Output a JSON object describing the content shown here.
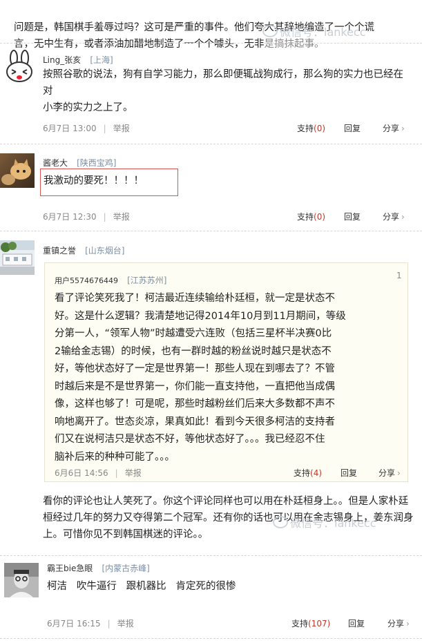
{
  "intro_text": "问题是，韩国棋手羞辱过吗？这可是严重的事件。他们夸大其辞地编造了一个个谎\n言，无中生有，或者添油加醋地制造了一个个噱头，无非",
  "intro_tail": "是搞抹起事。",
  "watermark_text": "微信号：lankecc",
  "watermark_icon": "wechat-icon",
  "colors": {
    "count_red": "#c0392b",
    "location_blue": "#7a8fa6",
    "highlight_red": "#d9534f",
    "quote_bg": "#fdfdf3"
  },
  "comments": [
    {
      "user": "Ling_张亥",
      "location": "[上海]",
      "text": "按照谷歌的说法，狗有自学习能力，那么即便辄战狗成行，那么狗的实力也已经在对\n小李的实力之上了。",
      "date": "6月7日 13:00",
      "report": "举报",
      "support": "支持",
      "support_count": "(0)",
      "reply": "回复",
      "share": "分享",
      "avatar_icon": "cartoon-rabbit-avatar"
    },
    {
      "user": "酱老大",
      "location": "[陕西宝鸡]",
      "text": "我激动的要死！！！！",
      "date": "6月7日 12:30",
      "report": "举报",
      "support": "支持",
      "support_count": "(0)",
      "reply": "回复",
      "share": "分享",
      "avatar_icon": "cat-photo-avatar"
    },
    {
      "user": "重镇之誉",
      "location": "[山东烟台]",
      "quote": {
        "user": "用户5574676449",
        "location": "[江苏苏州]",
        "floor": "1",
        "text": "看了评论笑死我了！柯洁最近连续输给朴廷桓，就一定是状态不\n好。这是什么逻辑？我清楚地记得2014年10月到11月期间，等级\n分第一人，“领军人物”时越遭受六连败（包括三星杯半决赛0比\n2输给金志锡）的时候，也有一群时越的粉丝说时越只是状态不\n好，等他状态好了一定是世界第一！那些人现在到哪去了？不管\n时越后来是不是世界第一，你们能一直支持他，一直把他当成偶\n像，这样也够了！可是呢，那些时越粉丝们后来大多数都不声不\n响地离开了。世态炎凉，果真如此！看到今天很多柯洁的支持者\n们又在说柯洁只是状态不好，等他状态好了。。。我已经忍不住\n脑补后来的种种可能了。。。",
        "date": "6月6日 14:56",
        "report": "举报",
        "support": "支持",
        "support_count": "(4)",
        "reply": "回复",
        "share": "分享"
      },
      "text": "看你的评论也让人笑死了。你这个评论同样也可以用在朴廷桓身上。。但是人家朴廷\n桓经过几年的努力又夺得第二个冠军。还有你的话也可以用在金志锡身上，姜东润身\n上。可惜你见不到韩国棋迷的评论。。",
      "avatar_icon": "building-photo-avatar"
    },
    {
      "user": "霸王bie急眼",
      "location": "[内蒙古赤峰]",
      "text": "柯洁   吹牛逼行   跟机器比   肯定死的很惨",
      "date": "6月7日 16:15",
      "report": "举报",
      "support": "支持",
      "support_count": "(107)",
      "reply": "回复",
      "share": "分享",
      "avatar_icon": "old-man-photo-avatar"
    }
  ]
}
